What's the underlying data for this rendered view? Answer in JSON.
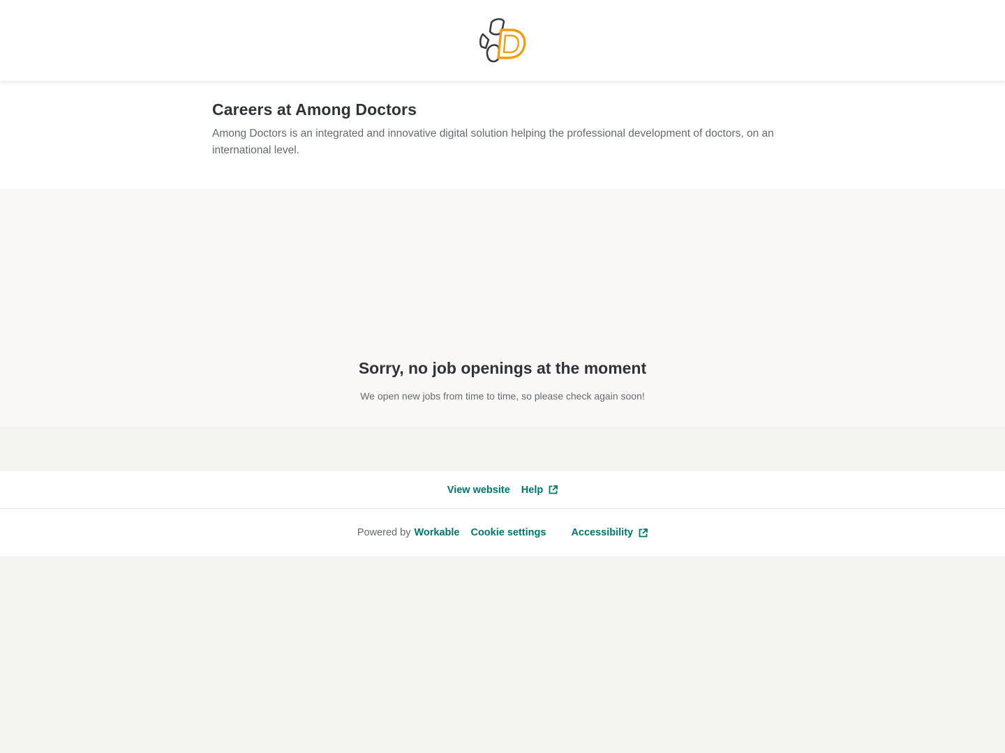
{
  "header": {
    "logo_icon": "among-doctors-logo",
    "brand_colors": {
      "dark": "#3b3b3b",
      "accent": "#f39c12"
    }
  },
  "intro": {
    "title": "Careers at Among Doctors",
    "description": "Among Doctors is an integrated and innovative digital solution helping the professional development of doctors, on an international level."
  },
  "empty_state": {
    "heading": "Sorry, no job openings at the moment",
    "message": "We open new jobs from time to time, so please check again soon!"
  },
  "links": {
    "view_website": "View website",
    "help": "Help"
  },
  "footer": {
    "powered_by": "Powered by",
    "workable": "Workable",
    "cookie_settings": "Cookie settings",
    "accessibility": "Accessibility"
  },
  "colors": {
    "link": "#00756a",
    "heading": "#2f3339",
    "muted": "#64696e",
    "empty_bg": "#faf8f6",
    "page_bg": "#f4f4f1"
  }
}
